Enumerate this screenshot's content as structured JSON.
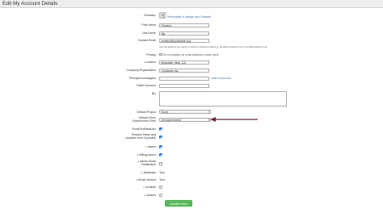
{
  "header": {
    "title": "Edit My Account Details"
  },
  "form": {
    "gravatar": {
      "label": "Gravatar:",
      "link": "Personalise or change your Gravatar"
    },
    "first_name": {
      "label": "First Name",
      "value": "Preston"
    },
    "last_name": {
      "label": "Last Name",
      "value": "Ng"
    },
    "contact_email": {
      "label": "Contact Email",
      "value": "preston@cytobank.org",
      "help": "Use the address you want to receive Cytobank email (e.g. jane@companyx.com or john@institution.org)"
    },
    "privacy": {
      "label": "Privacy",
      "text": "Do not display my email address to other users",
      "checked": false
    },
    "location": {
      "label": "Location",
      "value": "Mountain View, CA"
    },
    "company": {
      "label": "Company/Organization",
      "value": "Cytobank Inc."
    },
    "principal_investigator": {
      "label": "Principal Investigator",
      "link": "Invite a new user"
    },
    "twitter": {
      "label": "Twitter Account",
      "value": ""
    },
    "bio": {
      "label": "Bio",
      "value": ""
    },
    "default_project": {
      "label": "Default Project",
      "value": "None"
    },
    "default_filter": {
      "label_line1": "Default Inbox",
      "label_line2": "Experiments Filter",
      "value": "All experiments"
    },
    "email_notifications": {
      "label": "Email Notifications",
      "checked": true
    },
    "receive_news": {
      "label_line1": "Receive News and",
      "label_line2": "Updates from Cytobank",
      "checked": true
    },
    "admin": {
      "label": "Admin",
      "checked": true
    },
    "billing_admin": {
      "label": "Billing Admin",
      "checked": true
    },
    "admin_email_notification": {
      "label_line1": "Admin Email",
      "label_line2": "Notification",
      "checked": false
    },
    "database": {
      "label": "Database",
      "value": "True"
    },
    "email_verified": {
      "label": "Email Verified",
      "value": "True"
    },
    "invisible": {
      "label": "Invisible",
      "checked": false
    },
    "inactive": {
      "label": "Inactive",
      "checked": false
    },
    "submit": {
      "label": "Update User"
    }
  },
  "colors": {
    "arrow": "#7a1f3d",
    "button": "#5cb85c",
    "link": "#3a6ea5",
    "checkbox": "#3b82f6"
  },
  "icons": {
    "admin_marker": "key-icon"
  }
}
